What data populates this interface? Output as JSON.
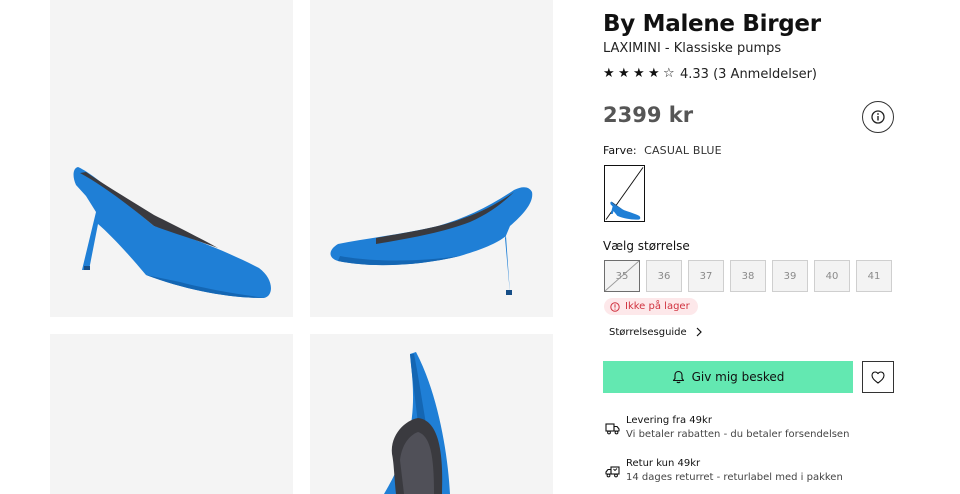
{
  "gallery": {
    "images": [
      {
        "name": "shoe-side-view-left"
      },
      {
        "name": "shoe-side-view-right"
      },
      {
        "name": "shoe-image-3"
      },
      {
        "name": "shoe-top-view"
      }
    ],
    "shoe_color": "#1f7fd6",
    "shoe_color_dark": "#1466b3",
    "insole_color": "#3a3a3f"
  },
  "product": {
    "brand": "By Malene Birger",
    "name": "LAXIMINI - Klassiske pumps",
    "rating": {
      "stars": [
        "★",
        "★",
        "★",
        "★",
        "☆"
      ],
      "value": 4.33,
      "text": "4.33 (3 Anmeldelser)"
    },
    "price": "2399 kr",
    "color_label": "Farve:",
    "color_value": "CASUAL BLUE",
    "size_title": "Vælg størrelse",
    "sizes": [
      {
        "label": "35",
        "available": false,
        "selected": true
      },
      {
        "label": "36",
        "available": false,
        "selected": false
      },
      {
        "label": "37",
        "available": false,
        "selected": false
      },
      {
        "label": "38",
        "available": false,
        "selected": false
      },
      {
        "label": "39",
        "available": false,
        "selected": false
      },
      {
        "label": "40",
        "available": false,
        "selected": false
      },
      {
        "label": "41",
        "available": false,
        "selected": false
      }
    ],
    "stock_status": "Ikke på lager",
    "size_guide": "Størrelsesguide",
    "notify_button": "Giv mig besked"
  },
  "usps": [
    {
      "icon": "truck-icon",
      "title": "Levering fra 49kr",
      "subtitle": "Vi betaler rabatten - du betaler forsendelsen"
    },
    {
      "icon": "return-truck-icon",
      "title": "Retur kun 49kr",
      "subtitle": "14 dages returret - returlabel med i pakken"
    }
  ],
  "colors": {
    "accent_green": "#63e8b1",
    "out_of_stock_bg": "#fde8ea",
    "out_of_stock_text": "#d0323f",
    "price_text": "#555555"
  },
  "icons": {
    "info": "info-icon",
    "bell": "bell-icon",
    "heart": "heart-icon",
    "chevron": "chevron-right-icon",
    "alert": "alert-circle-icon"
  }
}
